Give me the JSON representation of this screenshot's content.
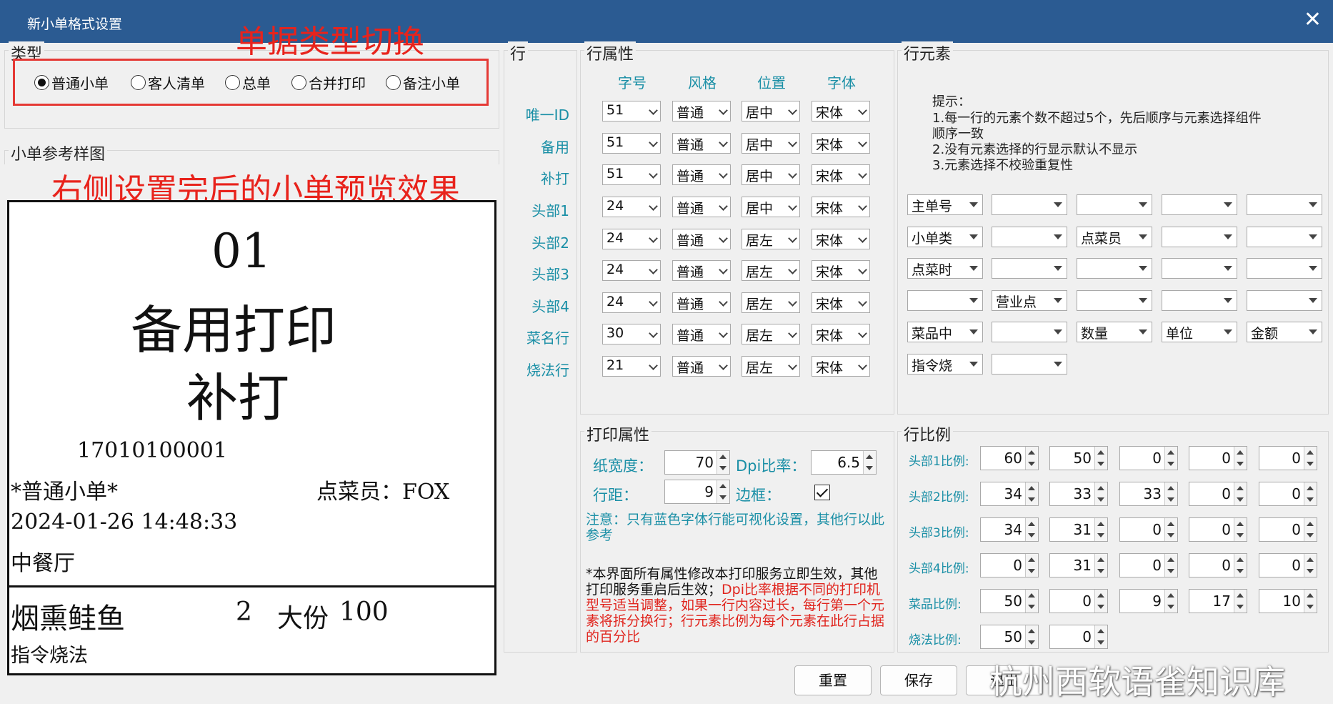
{
  "window": {
    "title": "新小单格式设置",
    "close": "✕"
  },
  "annotations": {
    "top": "单据类型切换",
    "preview": "右侧设置完后的小单预览效果"
  },
  "type_group": {
    "title": "类型",
    "options": [
      "普通小单",
      "客人清单",
      "总单",
      "合并打印",
      "备注小单"
    ],
    "selected": 0
  },
  "preview_group": {
    "title": "小单参考样图"
  },
  "preview": {
    "number": "01",
    "line1": "备用打印",
    "line2": "补打",
    "id": "17010100001",
    "type": "*普通小单*",
    "waiter": "点菜员：FOX",
    "datetime": "2024-01-26  14:48:33",
    "hall": "中餐厅",
    "dish": "烟熏鲑鱼",
    "qty": "2",
    "unit": "大份",
    "price": "100",
    "method": "指令烧法"
  },
  "rows_group": {
    "title": "行",
    "labels": [
      "唯一ID",
      "备用",
      "补打",
      "头部1",
      "头部2",
      "头部3",
      "头部4",
      "菜名行",
      "烧法行"
    ]
  },
  "row_attr": {
    "title": "行属性",
    "headers": [
      "字号",
      "风格",
      "位置",
      "字体"
    ],
    "rows": [
      [
        "51",
        "普通",
        "居中",
        "宋体"
      ],
      [
        "51",
        "普通",
        "居中",
        "宋体"
      ],
      [
        "51",
        "普通",
        "居中",
        "宋体"
      ],
      [
        "24",
        "普通",
        "居中",
        "宋体"
      ],
      [
        "24",
        "普通",
        "居左",
        "宋体"
      ],
      [
        "24",
        "普通",
        "居左",
        "宋体"
      ],
      [
        "24",
        "普通",
        "居左",
        "宋体"
      ],
      [
        "30",
        "普通",
        "居左",
        "宋体"
      ],
      [
        "21",
        "普通",
        "居左",
        "宋体"
      ]
    ]
  },
  "row_elem": {
    "title": "行元素",
    "hint_title": "提示：",
    "hints": [
      "1.每一行的元素个数不超过5个，先后顺序与元素选择组件",
      "顺序一致",
      "2.没有元素选择的行显示默认不显示",
      "3.元素选择不校验重复性"
    ],
    "grid": [
      [
        "主单号",
        "",
        "",
        "",
        ""
      ],
      [
        "小单类",
        "",
        "点菜员",
        "",
        ""
      ],
      [
        "点菜时",
        "",
        "",
        "",
        ""
      ],
      [
        "",
        "营业点",
        "",
        "",
        ""
      ],
      [
        "菜品中",
        "",
        "数量",
        "单位",
        "金额"
      ],
      [
        "指令烧",
        "",
        "",
        "",
        ""
      ]
    ]
  },
  "print_attr": {
    "title": "打印属性",
    "paper_width_label": "纸宽度：",
    "paper_width": "70",
    "dpi_label": "Dpi比率：",
    "dpi": "6.5",
    "row_gap_label": "行距：",
    "row_gap": "9",
    "border_label": "边框：",
    "note1": "注意：只有蓝色字体行能可视化设置，其他行以此参考",
    "note2_black": "*本界面所有属性修改本打印服务立即生效，其他打印服务重启后生效；",
    "note2_red": "Dpi比率根据不同的打印机型号适当调整，如果一行内容过长，每行第一个元素将拆分换行；行元素比例为每个元素在此行占据的百分比"
  },
  "ratio": {
    "title": "行比例",
    "labels": [
      "头部1比例:",
      "头部2比例:",
      "头部3比例:",
      "头部4比例:",
      "菜品比例:",
      "烧法比例:"
    ],
    "values": [
      [
        "60",
        "50",
        "0",
        "0",
        "0"
      ],
      [
        "34",
        "33",
        "33",
        "0",
        "0"
      ],
      [
        "34",
        "31",
        "0",
        "0",
        "0"
      ],
      [
        "0",
        "31",
        "0",
        "0",
        "0"
      ],
      [
        "50",
        "0",
        "9",
        "17",
        "10"
      ],
      [
        "50",
        "0"
      ]
    ]
  },
  "buttons": {
    "reset": "重置",
    "save": "保存",
    "exit": "退出"
  },
  "watermark": "杭州西软语雀知识库"
}
